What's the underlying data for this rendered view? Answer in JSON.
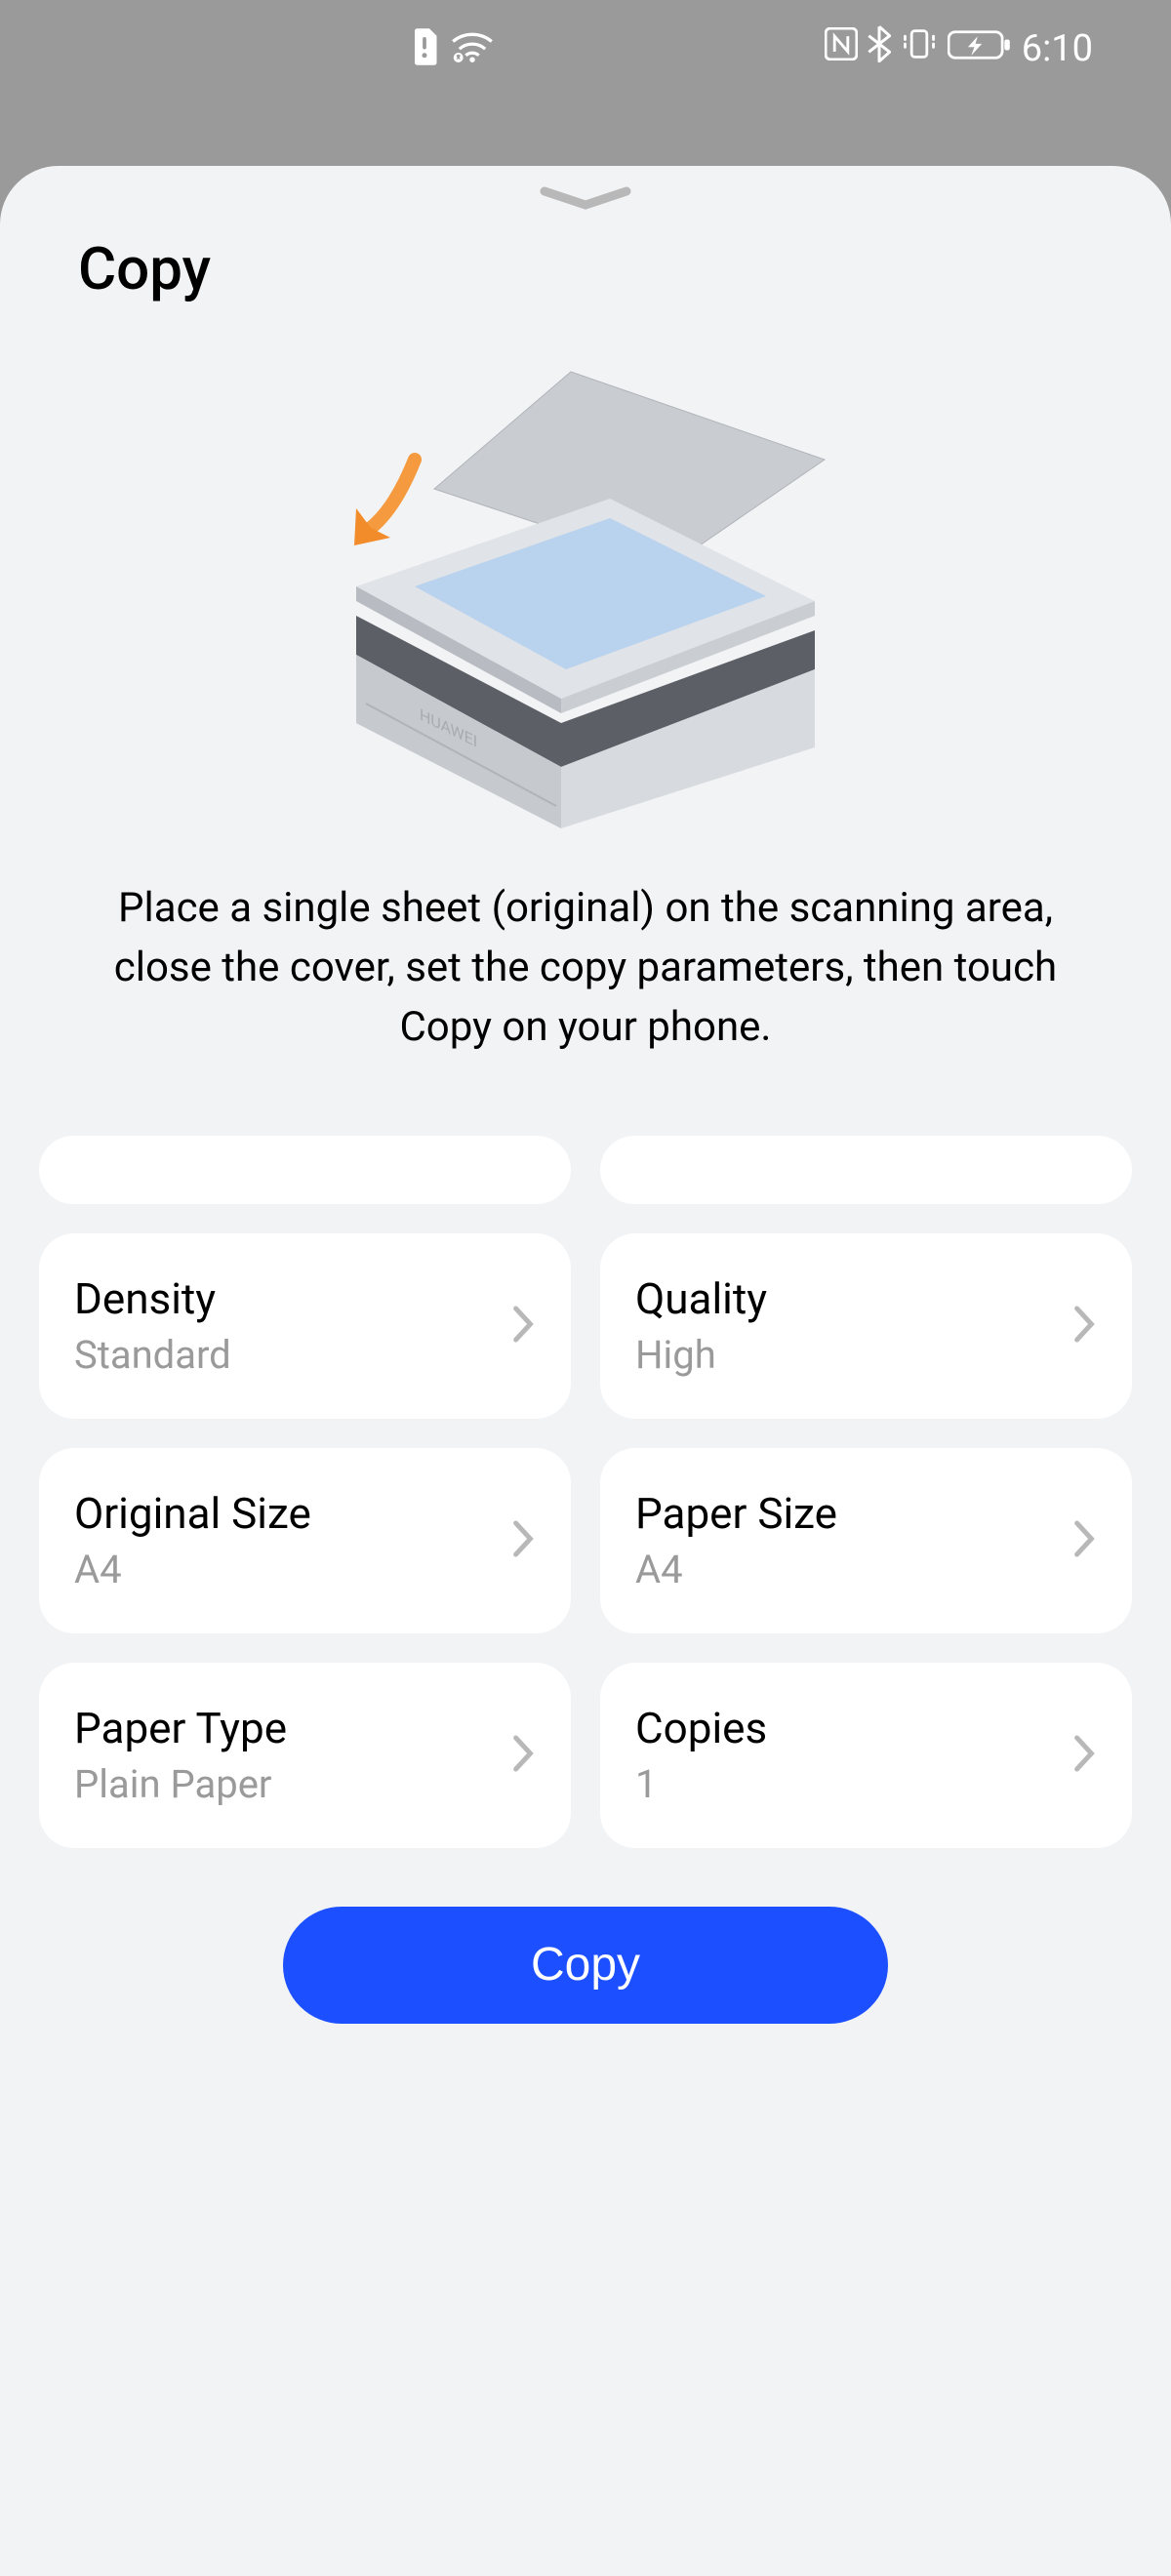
{
  "status": {
    "time": "6:10"
  },
  "sheet": {
    "title": "Copy",
    "instruction": "Place a single sheet (original) on the scanning area, close the cover, set the copy parameters, then touch Copy on your phone.",
    "printerBrand": "HUAWEI"
  },
  "settings": {
    "density": {
      "label": "Density",
      "value": "Standard"
    },
    "quality": {
      "label": "Quality",
      "value": "High"
    },
    "originalSize": {
      "label": "Original Size",
      "value": "A4"
    },
    "paperSize": {
      "label": "Paper Size",
      "value": "A4"
    },
    "paperType": {
      "label": "Paper Type",
      "value": "Plain Paper"
    },
    "copies": {
      "label": "Copies",
      "value": "1"
    }
  },
  "actions": {
    "copyLabel": "Copy"
  },
  "colors": {
    "accent": "#1b4fff",
    "sheetBg": "#f2f3f5"
  }
}
